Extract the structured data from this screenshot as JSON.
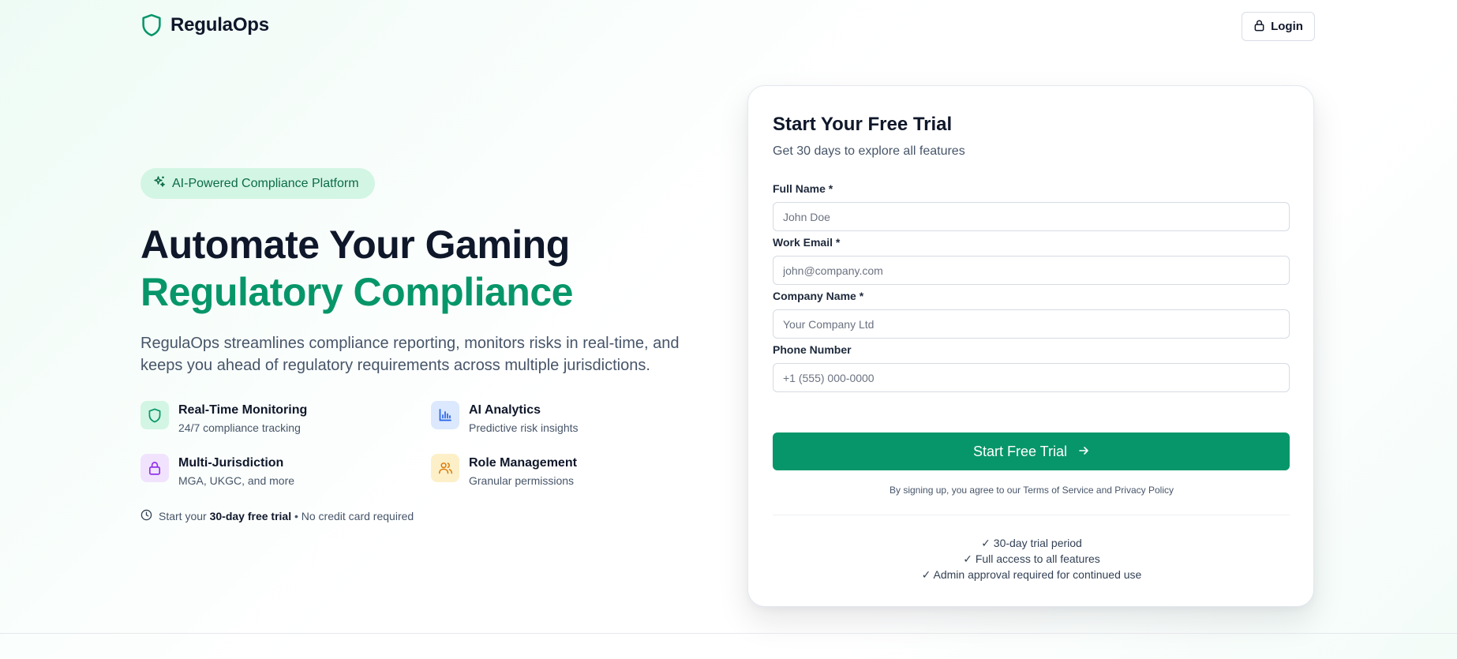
{
  "header": {
    "brand": "RegulaOps",
    "login_label": "Login"
  },
  "hero": {
    "badge": "AI-Powered Compliance Platform",
    "title_line1": "Automate Your Gaming",
    "title_line2": "Regulatory Compliance",
    "subtitle": "RegulaOps streamlines compliance reporting, monitors risks in real-time, and keeps you ahead of regulatory requirements across multiple jurisdictions.",
    "features": [
      {
        "title": "Real-Time Monitoring",
        "subtitle": "24/7 compliance tracking",
        "icon": "shield-icon",
        "color": "#079669",
        "bg": "#d3f5e4"
      },
      {
        "title": "AI Analytics",
        "subtitle": "Predictive risk insights",
        "icon": "bar-chart-icon",
        "color": "#2563eb",
        "bg": "#dbe8fd"
      },
      {
        "title": "Multi-Jurisdiction",
        "subtitle": "MGA, UKGC, and more",
        "icon": "lock-icon",
        "color": "#9333ea",
        "bg": "#f1e3fd"
      },
      {
        "title": "Role Management",
        "subtitle": "Granular permissions",
        "icon": "users-icon",
        "color": "#d97706",
        "bg": "#fdf0c8"
      }
    ],
    "trial_prefix": "Start your ",
    "trial_bold": "30-day free trial",
    "trial_suffix": " • No credit card required"
  },
  "form": {
    "title": "Start Your Free Trial",
    "subtitle": "Get 30 days to explore all features",
    "fields": [
      {
        "label": "Full Name *",
        "placeholder": "John Doe",
        "value": ""
      },
      {
        "label": "Work Email *",
        "placeholder": "john@company.com",
        "value": ""
      },
      {
        "label": "Company Name *",
        "placeholder": "Your Company Ltd",
        "value": ""
      },
      {
        "label": "Phone Number",
        "placeholder": "+1 (555) 000-0000",
        "value": ""
      }
    ],
    "submit_label": "Start Free Trial",
    "terms_prefix": "By signing up, you agree to our ",
    "terms_link": "Terms of Service",
    "terms_and": " and ",
    "privacy_link": "Privacy Policy",
    "perks": [
      "✓ 30-day trial period",
      "✓ Full access to all features",
      "✓ Admin approval required for continued use"
    ]
  },
  "colors": {
    "accent": "#079669",
    "badge_bg": "#d3f5e4",
    "text": "#0f172a",
    "muted": "#475569"
  }
}
